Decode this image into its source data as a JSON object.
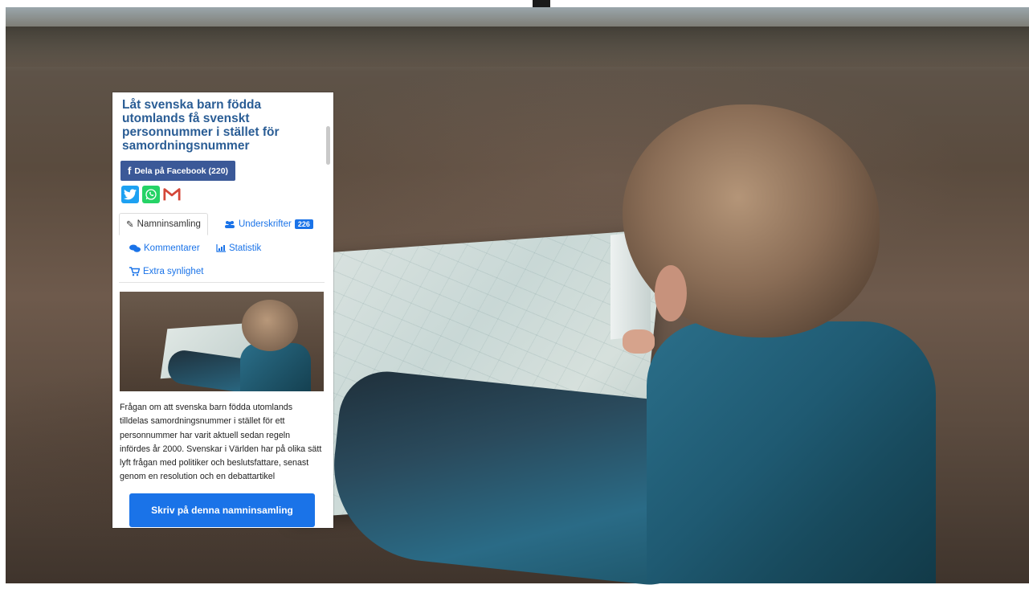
{
  "petition": {
    "title": "Låt svenska barn födda utomlands få svenskt personnummer i stället för samordningsnummer",
    "facebook_share_label": "Dela på Facebook (220)",
    "share_icons": [
      "twitter-icon",
      "whatsapp-icon",
      "gmail-icon"
    ],
    "tabs": [
      {
        "label": "Namninsamling",
        "icon": "pencil-icon",
        "active": true
      },
      {
        "label": "Underskrifter",
        "icon": "users-icon",
        "badge": "226"
      },
      {
        "label": "Kommentarer",
        "icon": "comments-icon"
      },
      {
        "label": "Statistik",
        "icon": "chart-icon"
      },
      {
        "label": "Extra synlighet",
        "icon": "cart-icon"
      }
    ],
    "description": "Frågan om att svenska barn födda utomlands tilldelas samordningsnummer i stället för ett personnummer har varit aktuell sedan regeln infördes år 2000. Svenskar i Världen har på olika sätt lyft frågan med politiker och beslutsfattare, senast genom en resolution och en debattartikel",
    "sign_button_label": "Skriv på denna namninsamling"
  },
  "colors": {
    "title": "#2a5d95",
    "facebook": "#3b5998",
    "twitter": "#1da1f2",
    "whatsapp": "#25d366",
    "gmail": "#d44638",
    "link": "#1a73e8",
    "primary_button": "#1a73e8"
  }
}
